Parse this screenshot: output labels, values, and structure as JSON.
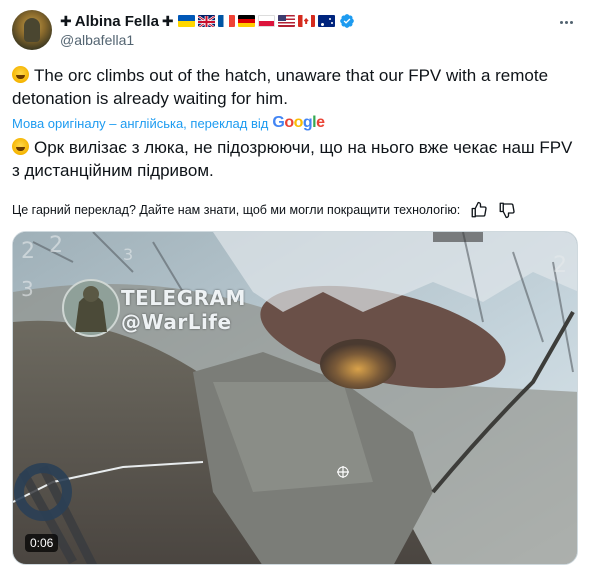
{
  "author": {
    "display_name": "Albina Fella",
    "cross_symbol": "✚",
    "handle": "@albafella1",
    "flags": [
      "ukraine",
      "united-kingdom",
      "france",
      "germany",
      "poland",
      "usa",
      "canada",
      "australia"
    ],
    "verified": true
  },
  "post": {
    "original_text": "The orc climbs out of the hatch, unaware that our FPV with a remote detonation is already waiting for him.",
    "emoji_name": "rolling-on-floor-laughing"
  },
  "translation": {
    "meta_label": "Мова оригіналу – англійська, переклад від",
    "provider": "Google",
    "translated_text": "Орк вилізає з люка, не підозрюючи, що на нього вже чекає наш FPV з дистанційним підривом.",
    "feedback_prompt": "Це гарний переклад? Дайте нам знати, щоб ми могли покращити технологію:"
  },
  "media": {
    "watermark_line1": "TELEGRAM",
    "watermark_line2": "@WarLife",
    "duration": "0:06"
  },
  "colors": {
    "link_blue": "#1d9bf0",
    "verified_blue": "#1d9bf0",
    "secondary_text": "#536471"
  }
}
